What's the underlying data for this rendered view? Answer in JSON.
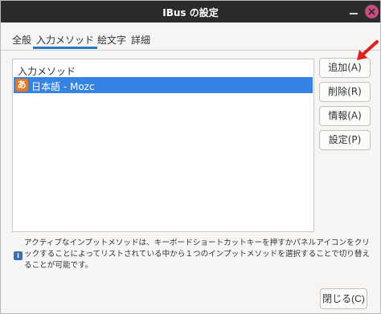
{
  "window": {
    "title": "IBus の設定"
  },
  "tabs": [
    {
      "label": "全般",
      "active": false
    },
    {
      "label": "入力メソッド",
      "active": true
    },
    {
      "label": "絵文字",
      "active": false
    },
    {
      "label": "詳細",
      "active": false
    }
  ],
  "input_methods": {
    "header": "入力メソッド",
    "items": [
      {
        "icon": "あ",
        "label": "日本語 - Mozc",
        "selected": true
      }
    ]
  },
  "buttons": {
    "add": "追加(A)",
    "remove": "削除(R)",
    "info": "情報(A)",
    "settings": "設定(P)"
  },
  "info_text": "アクティブなインプットメソッドは、キーボードショートカットキーを押すかパネルアイコンをクリックすることによってリストされている中から１つのインプットメソッドを選択することで切り替えることが可能です。",
  "footer": {
    "close": "閉じる(C)"
  },
  "colors": {
    "titlebar": "#2b2b2b",
    "selection": "#3584e4",
    "tab_underline": "#2a76c6",
    "close_button": "#c74f80",
    "annotation_arrow": "#e0201e"
  },
  "icons": {
    "engine": "mozc-hiragana-icon",
    "info": "info-icon",
    "close": "close-icon",
    "minimize": "minimize-icon",
    "annotation": "red-arrow-annotation"
  }
}
